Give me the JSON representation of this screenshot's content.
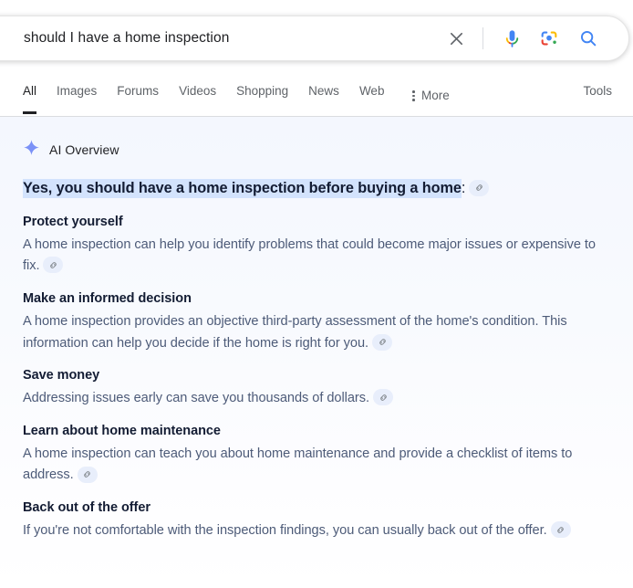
{
  "colors": {
    "google_blue": "#4285f4",
    "google_red": "#ea4335",
    "google_yellow": "#fbbc05",
    "google_green": "#34a853",
    "highlight": "#d3e3fd",
    "sparkle": "#7b92f7",
    "heading": "#131c33",
    "body_text": "#4d5b78",
    "chip_bg": "#e8eefb"
  },
  "search": {
    "value": "should I have a home inspection",
    "placeholder": "Search",
    "clear_icon": "close-icon",
    "mic_icon": "microphone-icon",
    "lens_icon": "google-lens-icon",
    "search_icon": "search-icon"
  },
  "nav": {
    "tabs": [
      {
        "label": "All",
        "active": true
      },
      {
        "label": "Images",
        "active": false
      },
      {
        "label": "Forums",
        "active": false
      },
      {
        "label": "Videos",
        "active": false
      },
      {
        "label": "Shopping",
        "active": false
      },
      {
        "label": "News",
        "active": false
      },
      {
        "label": "Web",
        "active": false
      }
    ],
    "more_label": "More",
    "more_icon": "three-dots-vertical-icon",
    "tools_label": "Tools"
  },
  "ai_overview": {
    "icon": "sparkle-icon",
    "label": "AI Overview",
    "answer": "Yes, you should have a home inspection before buying a home",
    "answer_suffix": ":",
    "citation_icon": "link-icon",
    "sections": [
      {
        "title": "Protect yourself",
        "body": "A home inspection can help you identify problems that could become major issues or expensive to fix."
      },
      {
        "title": "Make an informed decision",
        "body": "A home inspection provides an objective third-party assessment of the home's condition. This information can help you decide if the home is right for you."
      },
      {
        "title": "Save money",
        "body": "Addressing issues early can save you thousands of dollars."
      },
      {
        "title": "Learn about home maintenance",
        "body": "A home inspection can teach you about home maintenance and provide a checklist of items to address."
      },
      {
        "title": "Back out of the offer",
        "body": "If you're not comfortable with the inspection findings, you can usually back out of the offer."
      }
    ]
  }
}
